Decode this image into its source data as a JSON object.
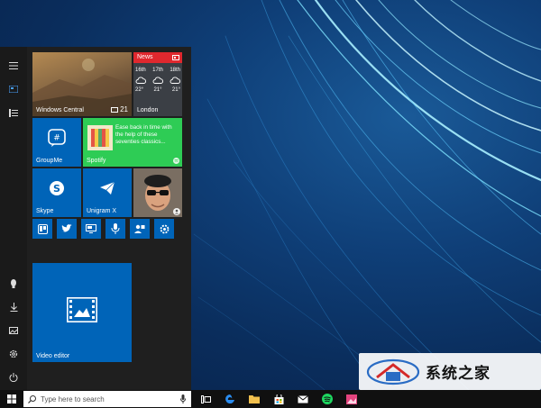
{
  "tiles": {
    "windows_central": {
      "label": "Windows Central",
      "badge": "21"
    },
    "news": {
      "label": "News",
      "location": "London",
      "forecast": [
        {
          "day": "16th",
          "temp": "22°"
        },
        {
          "day": "17th",
          "temp": "21°"
        },
        {
          "day": "18th",
          "temp": "21°"
        }
      ]
    },
    "groupme": {
      "label": "GroupMe"
    },
    "spotify": {
      "label": "Spotify",
      "text": "Ease back in time with the help of these seventies classics..."
    },
    "skype": {
      "label": "Skype"
    },
    "unigram": {
      "label": "Unigram X"
    },
    "video_editor": {
      "label": "Video editor"
    }
  },
  "taskbar": {
    "search_placeholder": "Type here to search"
  },
  "watermark": {
    "text": "系统之家"
  },
  "colors": {
    "accent": "#0064b8",
    "spotify_green": "#2ecc55",
    "news_red": "#e0282e",
    "start_bg": "#1f1f1f",
    "taskbar_bg": "#101010"
  }
}
